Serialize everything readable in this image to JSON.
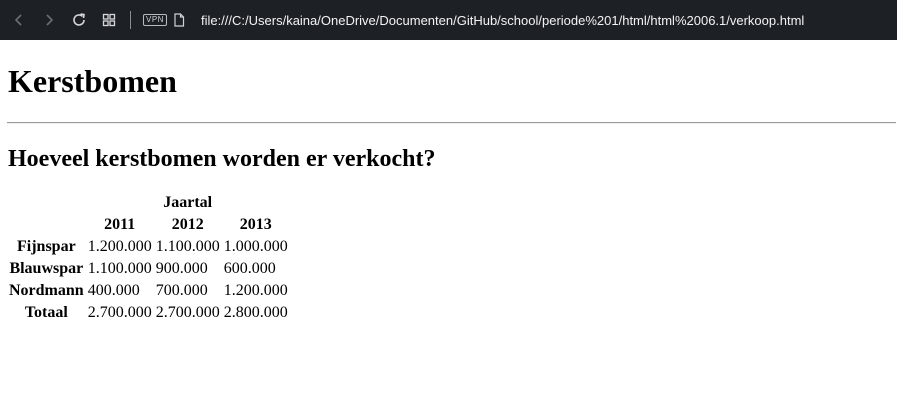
{
  "browser": {
    "vpn_label": "VPN",
    "url": "file:///C:/Users/kaina/OneDrive/Documenten/GitHub/school/periode%201/html/html%2006.1/verkoop.html"
  },
  "page": {
    "title": "Kerstbomen",
    "question": "Hoeveel kerstbomen worden er verkocht?"
  },
  "table": {
    "group_header": "Jaartal",
    "years": [
      "2011",
      "2012",
      "2013"
    ],
    "rows": [
      {
        "label": "Fijnspar",
        "values": [
          "1.200.000",
          "1.100.000",
          "1.000.000"
        ]
      },
      {
        "label": "Blauwspar",
        "values": [
          "1.100.000",
          "900.000",
          "600.000"
        ]
      },
      {
        "label": "Nordmann",
        "values": [
          "400.000",
          "700.000",
          "1.200.000"
        ]
      },
      {
        "label": "Totaal",
        "values": [
          "2.700.000",
          "2.700.000",
          "2.800.000"
        ]
      }
    ]
  }
}
